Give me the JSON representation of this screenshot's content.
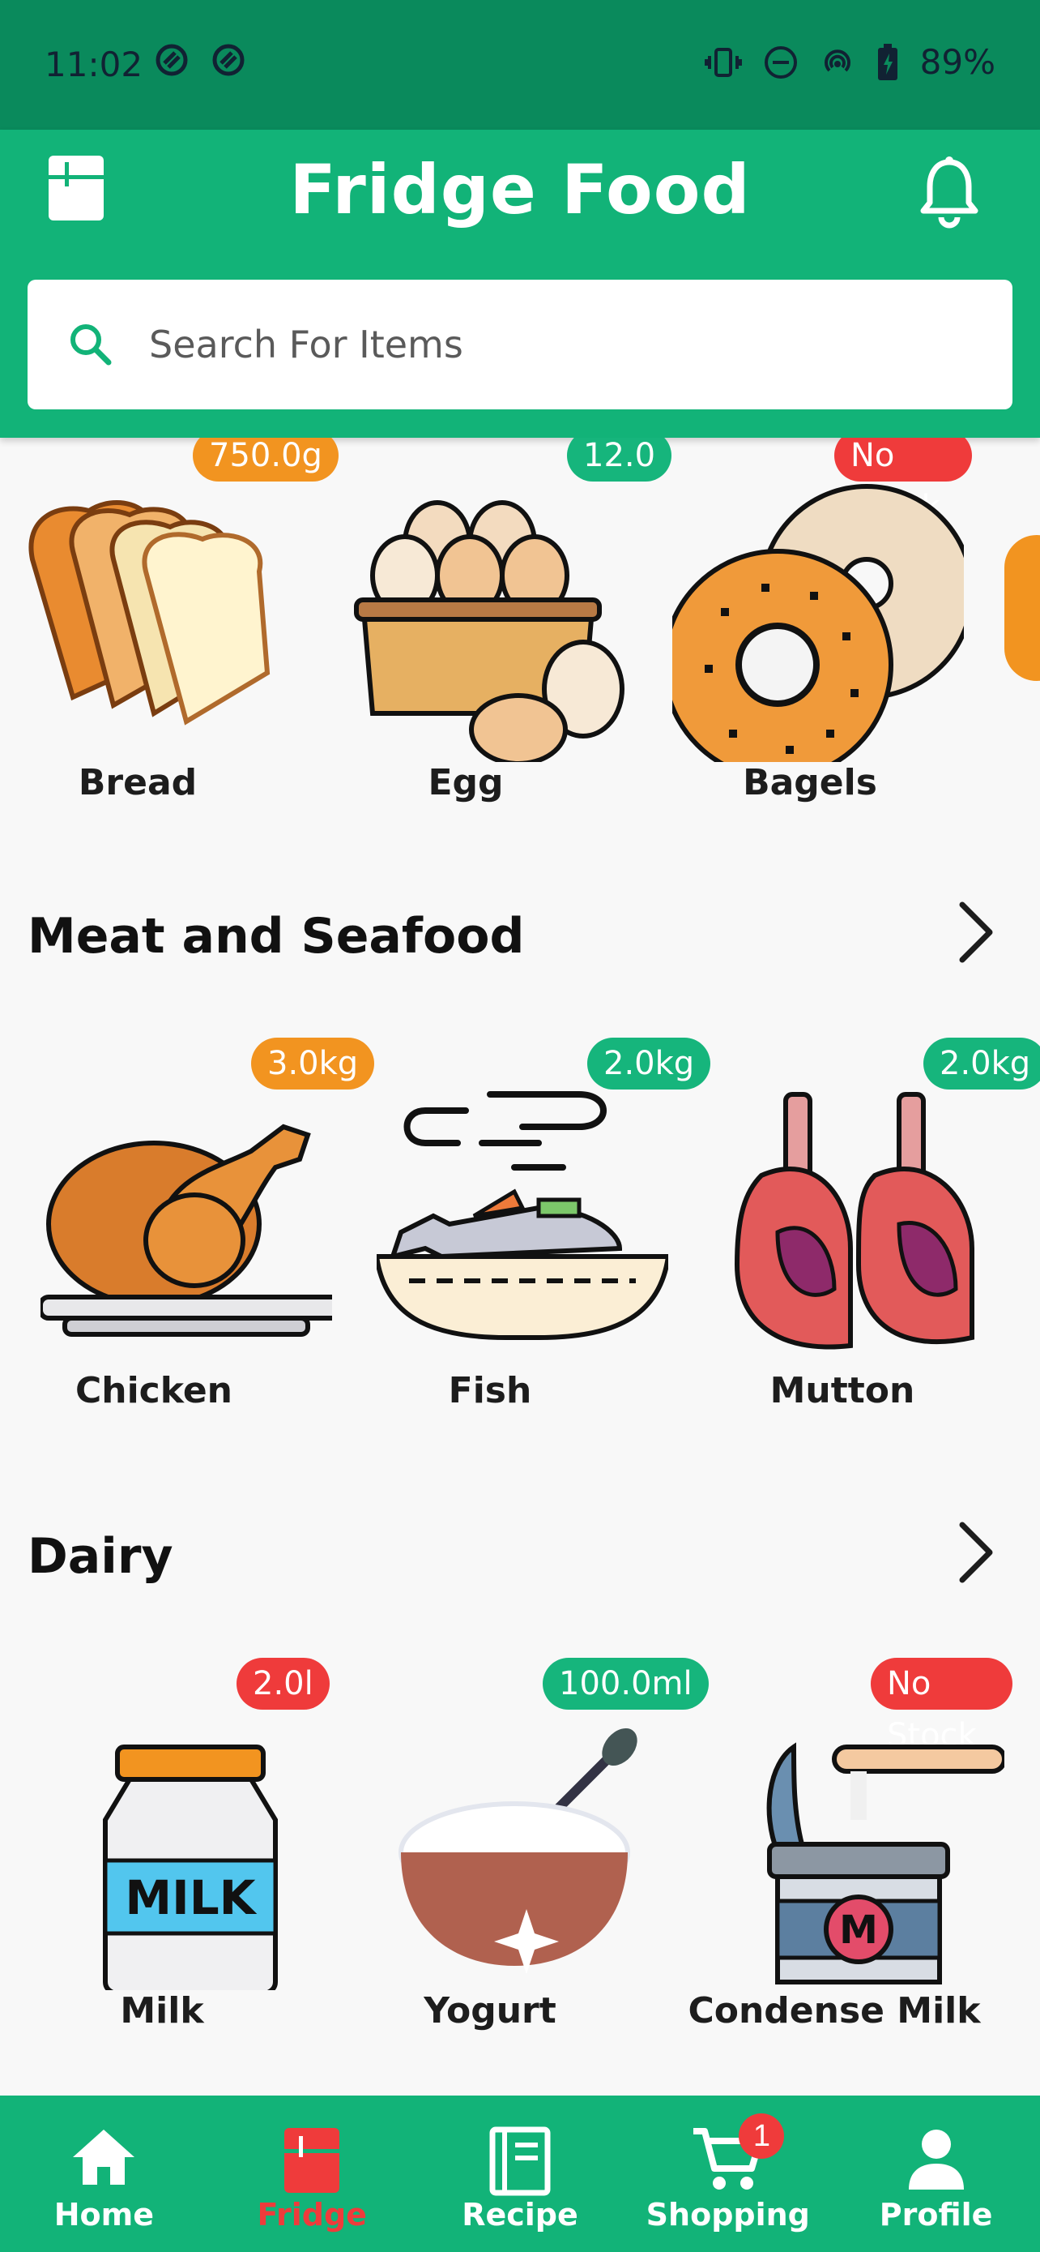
{
  "status_bar": {
    "time": "11:02",
    "battery": "89%"
  },
  "app_bar": {
    "title": "Fridge Food"
  },
  "search": {
    "placeholder": "Search For Items"
  },
  "sections": [
    {
      "title": "",
      "items": [
        {
          "name": "Bread",
          "quantity": "750.0g",
          "badge_color": "#f29420"
        },
        {
          "name": "Egg",
          "quantity": "12.0",
          "badge_color": "#16b57c"
        },
        {
          "name": "Bagels",
          "quantity": "No Stock",
          "badge_color": "#ef3b3b"
        }
      ]
    },
    {
      "title": "Meat and Seafood",
      "items": [
        {
          "name": "Chicken",
          "quantity": "3.0kg",
          "badge_color": "#f29420"
        },
        {
          "name": "Fish",
          "quantity": "2.0kg",
          "badge_color": "#16b57c"
        },
        {
          "name": "Mutton",
          "quantity": "2.0kg",
          "badge_color": "#16b57c"
        }
      ]
    },
    {
      "title": "Dairy",
      "items": [
        {
          "name": "Milk",
          "quantity": "2.0l",
          "badge_color": "#ef3b3b"
        },
        {
          "name": "Yogurt",
          "quantity": "100.0ml",
          "badge_color": "#16b57c"
        },
        {
          "name": "Condense Milk",
          "quantity": "No Stock",
          "badge_color": "#ef3b3b"
        }
      ]
    }
  ],
  "bottom_nav": {
    "items": [
      {
        "label": "Home",
        "icon": "home-icon"
      },
      {
        "label": "Fridge",
        "icon": "fridge-icon",
        "active": true
      },
      {
        "label": "Recipe",
        "icon": "recipe-book-icon"
      },
      {
        "label": "Shopping",
        "icon": "shopping-cart-icon",
        "badge": "1"
      },
      {
        "label": "Profile",
        "icon": "profile-icon"
      }
    ]
  },
  "colors": {
    "primary": "#12b378",
    "status_bar": "#0a8a5c",
    "accent_red": "#ef3b3b"
  }
}
